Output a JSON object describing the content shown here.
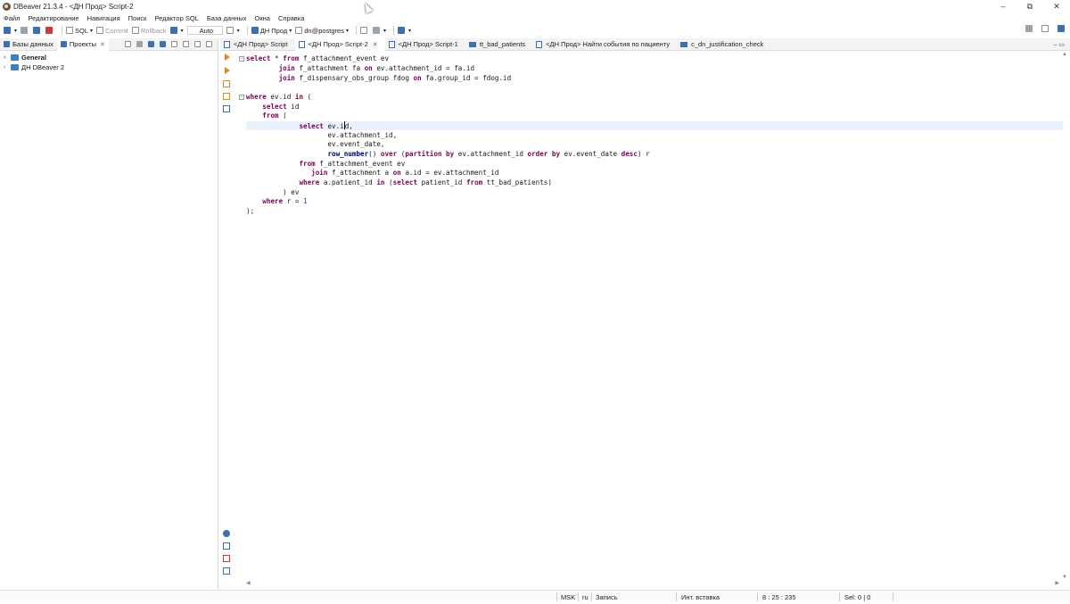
{
  "window": {
    "title": "DBeaver 21.3.4 - <ДН Прод> Script-2",
    "controls": {
      "minimize": "–",
      "maximize": "⧉",
      "close": "✕"
    }
  },
  "menu": [
    "Файл",
    "Редактирование",
    "Навигация",
    "Поиск",
    "Редактор SQL",
    "База данных",
    "Окна",
    "Справка"
  ],
  "toolbar": {
    "sql_label": "SQL",
    "commit_label": "Commit",
    "rollback_label": "Rollback",
    "transaction_mode": "Auto",
    "connection": "ДН Прод",
    "schema": "dn@postgres"
  },
  "left_panel": {
    "tabs": [
      {
        "label": "Базы данных",
        "active": false
      },
      {
        "label": "Проекты",
        "active": true
      }
    ],
    "tree": [
      {
        "label": "General",
        "bold": true
      },
      {
        "label": "ДН DBeaver 2",
        "bold": false
      }
    ]
  },
  "editor_tabs": [
    {
      "label": "<ДН Прод> Script",
      "active": false,
      "type": "script"
    },
    {
      "label": "<ДН Прод> Script-2",
      "active": true,
      "type": "script"
    },
    {
      "label": "<ДН Прод> Script-1",
      "active": false,
      "type": "script"
    },
    {
      "label": "tt_bad_patients",
      "active": false,
      "type": "table"
    },
    {
      "label": "<ДН Прод> Найти события по пациенту",
      "active": false,
      "type": "script"
    },
    {
      "label": "c_dn_justification_check",
      "active": false,
      "type": "table"
    }
  ],
  "editor": {
    "lines": [
      "select * from f_attachment_event ev",
      "        join f_attachment fa on ev.attachment_id = fa.id",
      "        join f_dispensary_obs_group fdog on fa.group_id = fdog.id",
      "",
      "where ev.id in (",
      "    select id",
      "    from (",
      "             select ev.id,",
      "                    ev.attachment_id,",
      "                    ev.event_date,",
      "                    row_number() over (partition by ev.attachment_id order by ev.event_date desc) r",
      "             from f_attachment_event ev",
      "                join f_attachment a on a.id = ev.attachment_id",
      "             where a.patient_id in (select patient_id from tt_bad_patients)",
      "         ) ev",
      "    where r = 1",
      ");"
    ],
    "current_line": 8
  },
  "status": {
    "timezone": "MSK",
    "locale": "ru",
    "mode": "Запись",
    "insert_mode": "Инт. вставка",
    "position": "8 : 25 : 235",
    "selection": "Sel: 0 | 0"
  }
}
